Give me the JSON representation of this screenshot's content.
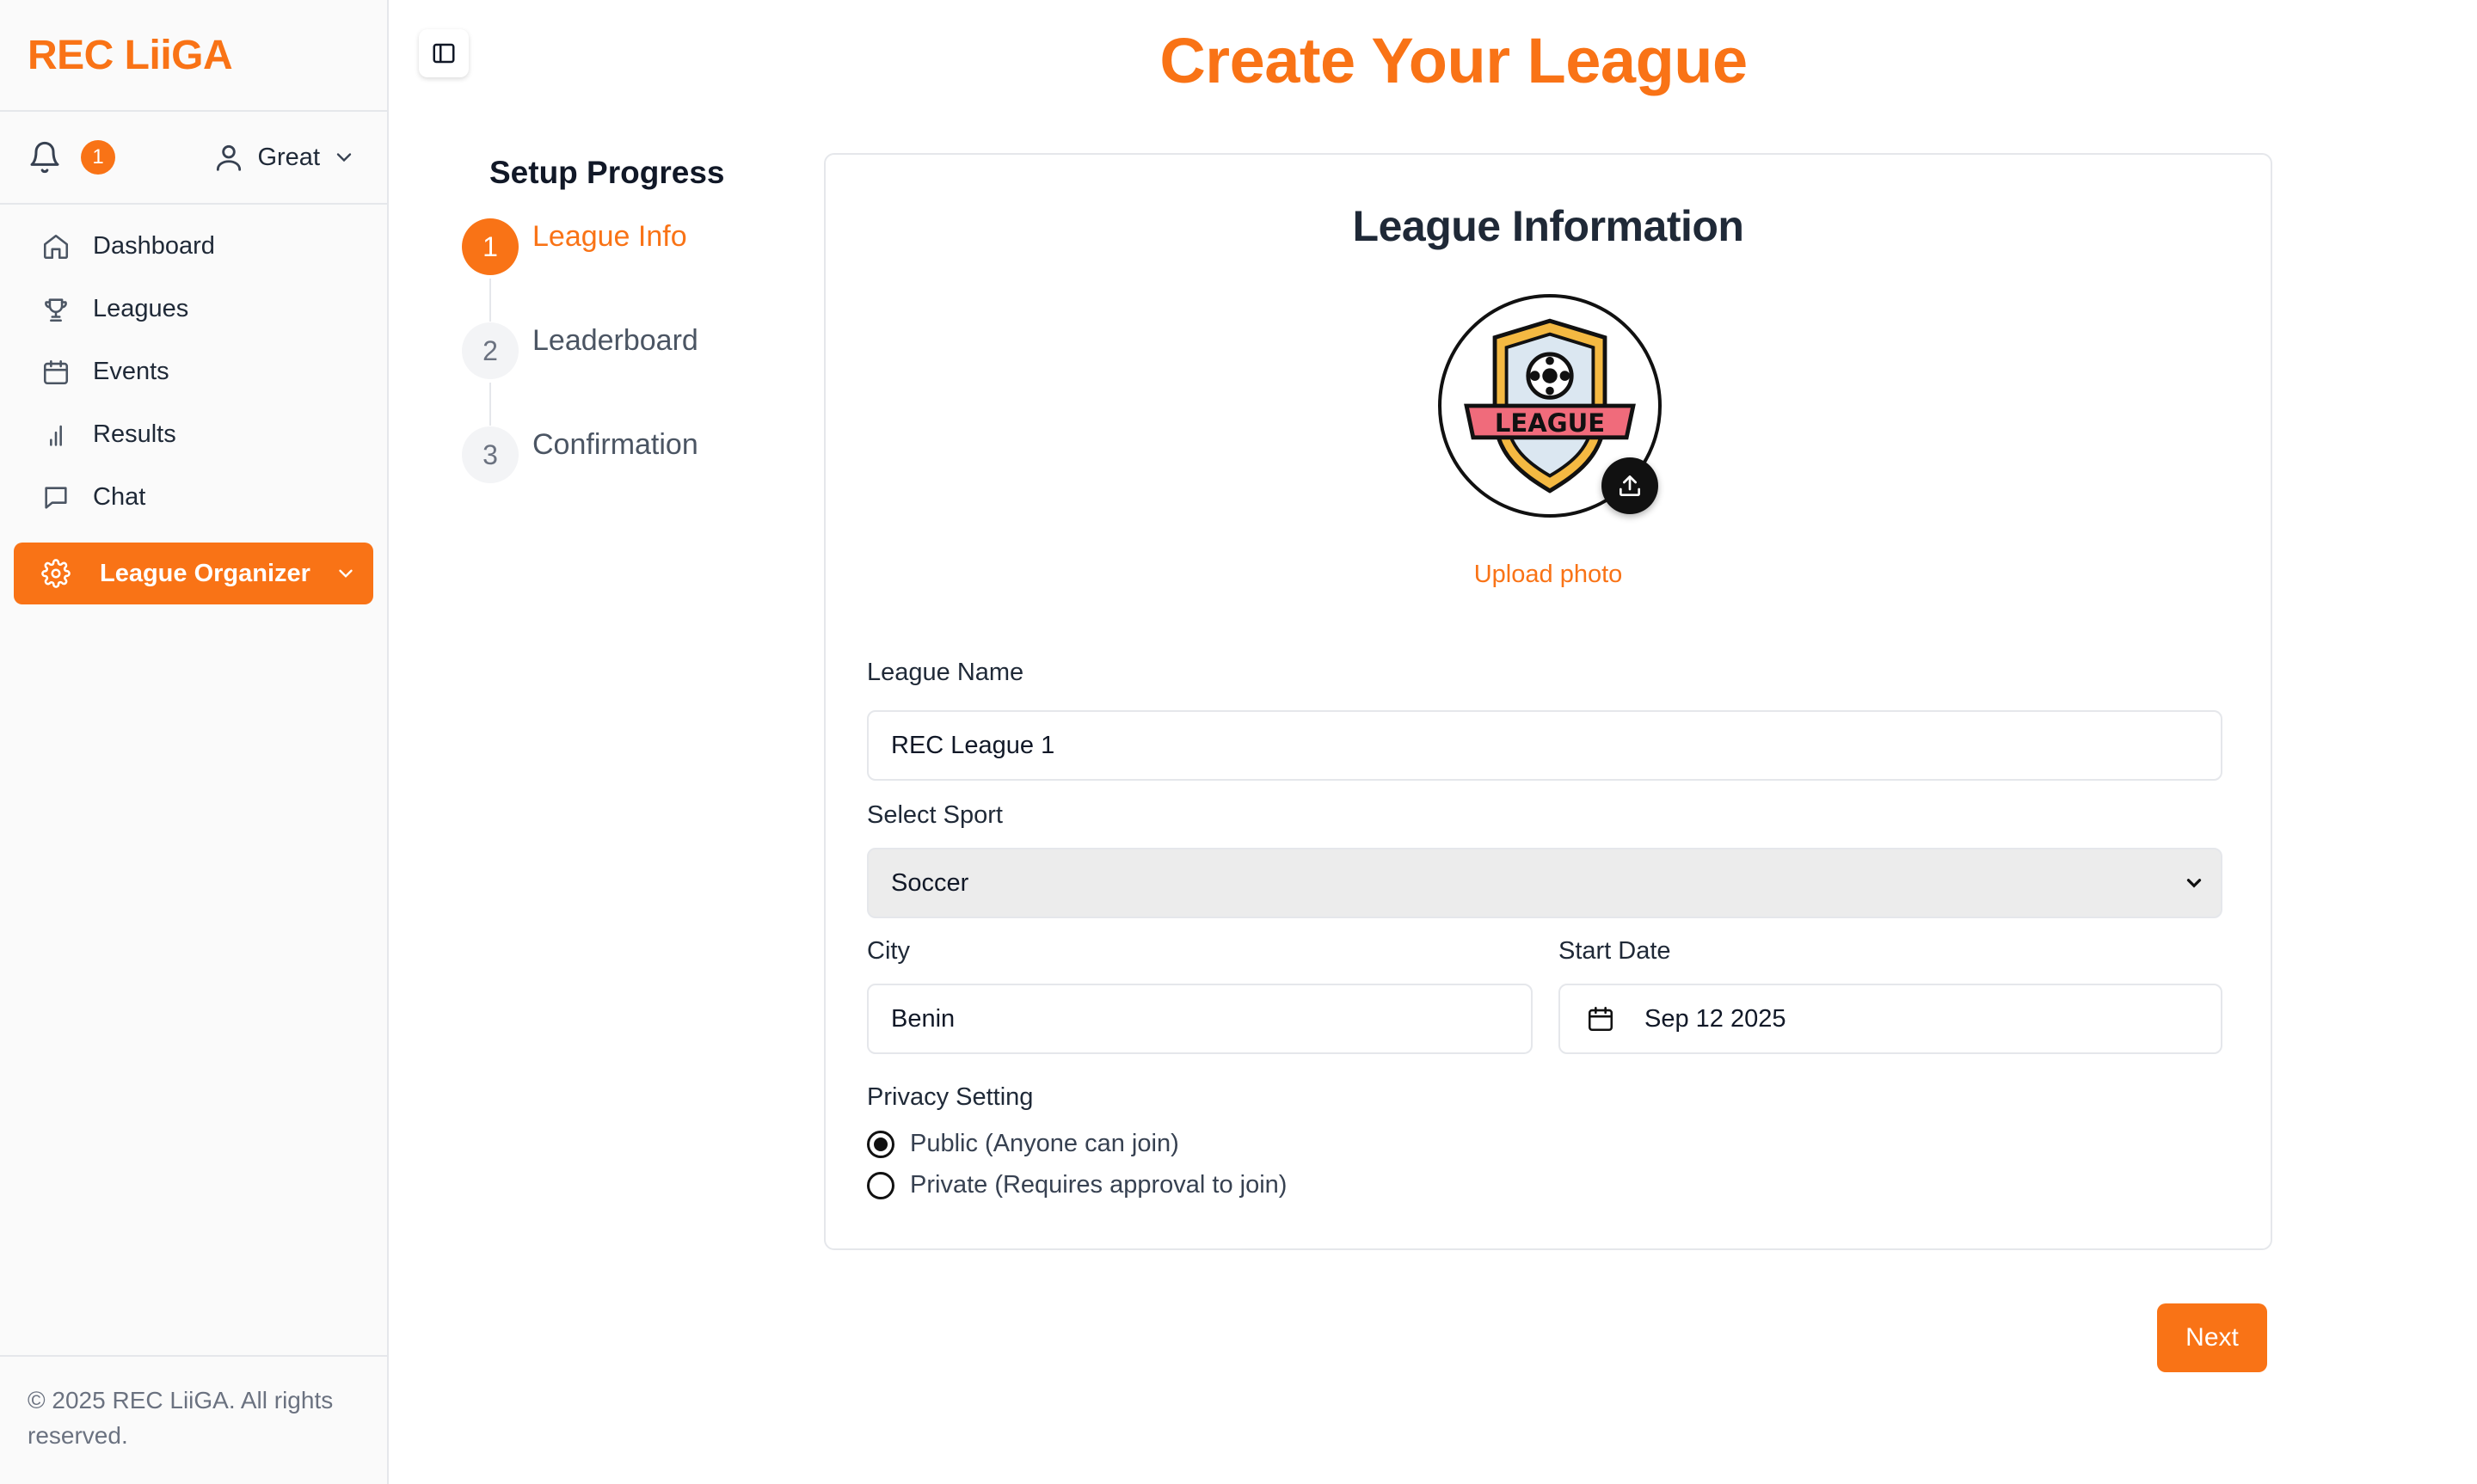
{
  "brand": {
    "name": "REC LiiGA"
  },
  "topbar": {
    "notification_count": "1",
    "user_name": "Great"
  },
  "nav": {
    "items": [
      {
        "label": "Dashboard",
        "icon": "home-icon"
      },
      {
        "label": "Leagues",
        "icon": "trophy-icon"
      },
      {
        "label": "Events",
        "icon": "calendar-icon"
      },
      {
        "label": "Results",
        "icon": "bar-chart-icon"
      },
      {
        "label": "Chat",
        "icon": "chat-icon"
      }
    ],
    "organizer_label": "League Organizer"
  },
  "footer": {
    "text": "© 2025 REC LiiGA. All rights reserved."
  },
  "page": {
    "title": "Create Your League"
  },
  "progress": {
    "title": "Setup Progress",
    "steps": [
      {
        "num": "1",
        "label": "League Info",
        "active": true
      },
      {
        "num": "2",
        "label": "Leaderboard",
        "active": false
      },
      {
        "num": "3",
        "label": "Confirmation",
        "active": false
      }
    ]
  },
  "form": {
    "title": "League Information",
    "logo_text": "LEAGUE",
    "upload_label": "Upload photo",
    "league_name": {
      "label": "League Name",
      "value": "REC League 1"
    },
    "sport": {
      "label": "Select Sport",
      "value": "Soccer"
    },
    "city": {
      "label": "City",
      "value": "Benin"
    },
    "start_date": {
      "label": "Start Date",
      "value": "Sep 12 2025"
    },
    "privacy": {
      "label": "Privacy Setting",
      "options": [
        {
          "label": "Public (Anyone can join)",
          "selected": true
        },
        {
          "label": "Private (Requires approval to join)",
          "selected": false
        }
      ]
    }
  },
  "actions": {
    "next_label": "Next"
  },
  "colors": {
    "accent": "#f97316",
    "sidebar_bg": "#fafafa",
    "border": "#e5e7eb"
  }
}
